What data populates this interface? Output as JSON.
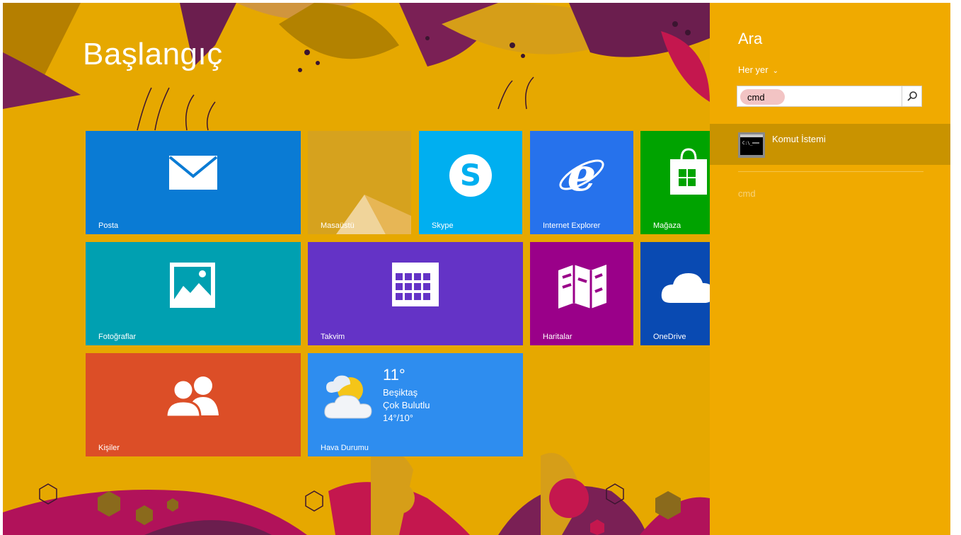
{
  "start": {
    "title": "Başlangıç",
    "tiles": {
      "posta": "Posta",
      "masaustu": "Masaüstü",
      "skype": "Skype",
      "ie": "Internet Explorer",
      "magaza": "Mağaza",
      "fotograflar": "Fotoğraflar",
      "takvim": "Takvim",
      "haritalar": "Haritalar",
      "onedrive": "OneDrive",
      "kisiler": "Kişiler",
      "hava": "Hava Durumu"
    },
    "weather": {
      "temp": "11°",
      "city": "Beşiktaş",
      "condition": "Çok Bulutlu",
      "range": "14°/10°"
    }
  },
  "search": {
    "title": "Ara",
    "scope": "Her yer",
    "query": "cmd",
    "results": [
      {
        "label": "Komut İstemi",
        "icon": "command-prompt-icon"
      }
    ],
    "suggestions": [
      "cmd"
    ]
  },
  "colors": {
    "background": "#E6A800",
    "pane": "#F0AA00",
    "mail": "#0A7BD4",
    "skype": "#00AFF0",
    "ie": "#2672EC",
    "store": "#00A300",
    "photos": "#00A0B1",
    "calendar": "#6433C6",
    "maps": "#9A0089",
    "onedrive": "#094AB2",
    "people": "#DC4E27",
    "weather": "#2E8DEF"
  }
}
